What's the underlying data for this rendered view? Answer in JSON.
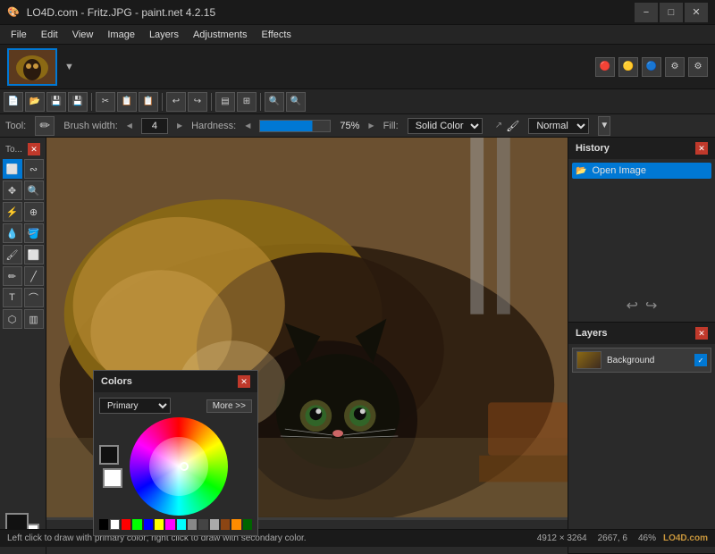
{
  "titleBar": {
    "appIcon": "🎨",
    "title": "LO4D.com - Fritz.JPG - paint.net 4.2.15",
    "controls": [
      "−",
      "□",
      "✕"
    ]
  },
  "menuBar": {
    "items": [
      "File",
      "Edit",
      "View",
      "Image",
      "Layers",
      "Adjustments",
      "Effects"
    ]
  },
  "toolOptions": {
    "toolLabel": "Tool:",
    "brushWidthLabel": "Brush width:",
    "brushWidth": "4",
    "hardnessLabel": "Hardness:",
    "hardnessValue": "75%",
    "fillLabel": "Fill:",
    "fillValue": "Solid Color",
    "blendMode": "Normal"
  },
  "topToolbar": {
    "buttons": [
      "📄",
      "📂",
      "💾",
      "✂",
      "📋",
      "📋",
      "🔄",
      "↩",
      "↪",
      "▤",
      "⊞",
      "🔍",
      "🔍"
    ]
  },
  "historyPanel": {
    "title": "History",
    "items": [
      {
        "label": "Open Image",
        "active": true
      }
    ],
    "undoLabel": "↩",
    "redoLabel": "↪"
  },
  "layersPanel": {
    "title": "Layers",
    "layers": [
      {
        "name": "Background",
        "visible": true
      }
    ]
  },
  "colorsPanel": {
    "title": "Colors",
    "closeBtn": "✕",
    "modeLabel": "Primary",
    "moreLabel": "More >>",
    "swatches": [
      "#000000",
      "#ffffff",
      "#ff0000",
      "#00ff00",
      "#0000ff",
      "#ffff00",
      "#ff00ff",
      "#00ffff",
      "#888888",
      "#444444",
      "#aaaaaa",
      "#8b4513",
      "#ff8c00",
      "#006400",
      "#00008b",
      "#800080",
      "#ffd700",
      "#ff69b4"
    ]
  },
  "statusBar": {
    "leftText": "Left click to draw with primary color; right click to draw with secondary color.",
    "resolution": "4912 × 3264",
    "coordinates": "2667, 6",
    "zoom": "46%",
    "brand": "LO4D.com"
  },
  "canvas": {
    "imageDescription": "Siamese cat lying on carpet"
  }
}
